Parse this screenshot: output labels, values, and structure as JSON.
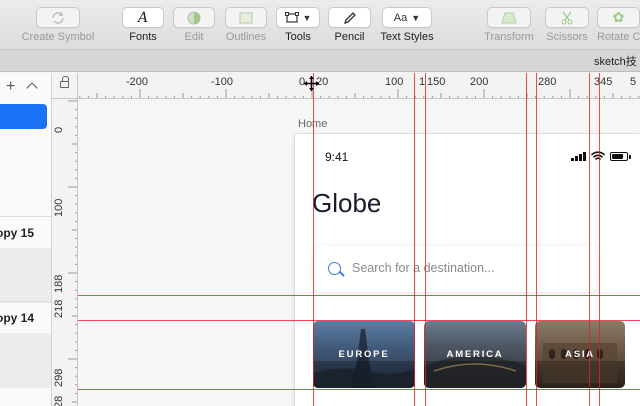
{
  "toolbar": {
    "create_symbol": "Create Symbol",
    "fonts": "Fonts",
    "edit": "Edit",
    "outlines": "Outlines",
    "tools": "Tools",
    "pencil": "Pencil",
    "text_styles": "Text Styles",
    "transform": "Transform",
    "scissors": "Scissors",
    "rotate_copies": "Rotate C",
    "text_styles_glyph": "Aa"
  },
  "tabbar": {
    "document_name": "sketch技"
  },
  "layers": {
    "groups": [
      {
        "label": "opy 15"
      },
      {
        "label": "opy 14"
      }
    ]
  },
  "rulers": {
    "horizontal": [
      "-200",
      "-100",
      "0",
      "20",
      "100",
      "150",
      "200",
      "280",
      "345",
      "5"
    ],
    "horizontal_extra": "1",
    "vertical": [
      "0",
      "100",
      "188",
      "218",
      "298",
      "28"
    ]
  },
  "artboard": {
    "name": "Home",
    "status_time": "9:41",
    "title": "Globe",
    "search_placeholder": "Search for a destination...",
    "cards": [
      {
        "label": "EUROPE"
      },
      {
        "label": "AMERICA"
      },
      {
        "label": "ASIA"
      }
    ]
  },
  "colors": {
    "selection": "#1a73f5",
    "guide": "#e0202a",
    "search_icon": "#3a7bd5"
  }
}
